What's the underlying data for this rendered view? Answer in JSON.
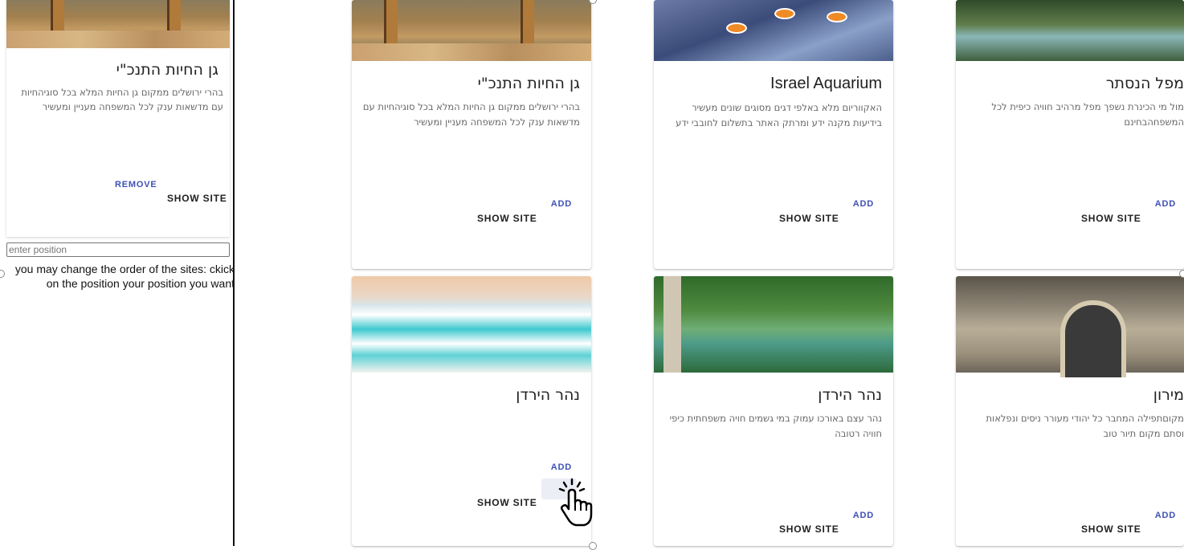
{
  "sidebar": {
    "selected_card": {
      "title": "גן החיות התנכ\"י",
      "description": "בהרי ירושלים ממקום גן החיות המלא בכל סוגיהחיות עם מדשאות ענק לכל המשפחה מעניין ומעשיר",
      "remove_label": "REMOVE",
      "show_site_label": "SHOW SITE"
    },
    "position_input": {
      "placeholder": "enter position",
      "value": ""
    },
    "hint": "you may change the order of the sites: ckick on the position your position you want"
  },
  "cards": [
    {
      "title": "גן החיות התנכ\"י",
      "description": "בהרי ירושלים ממקום גן החיות המלא בכל סוגיהחיות עם מדשאות ענק לכל המשפחה מעניין ומעשיר",
      "add_label": "ADD",
      "show_site_label": "SHOW SITE"
    },
    {
      "title": "Israel Aquarium",
      "description": "האקווריום מלא באלפי דגים מסוגים שונים מעשיר בידיעות מקנה ידע ומרתק האתר בתשלום לחובבי ידע",
      "add_label": "ADD",
      "show_site_label": "SHOW SITE"
    },
    {
      "title": "מפל הנסתר",
      "description": "מול מי הכינרת נשפך מפל מרהיב חוויה כיפית לכל המשפחהבחינם",
      "add_label": "ADD",
      "show_site_label": "SHOW SITE"
    },
    {
      "title": "נהר הירדן",
      "description": "",
      "add_label": "ADD",
      "show_site_label": "SHOW SITE"
    },
    {
      "title": "נהר הירדן",
      "description": "נהר עצם באורכו עמוק במי גשמים חויה משפחתית כיפי חוויה רטובה",
      "add_label": "ADD",
      "show_site_label": "SHOW SITE"
    },
    {
      "title": "מירון",
      "description": "מקוםתפילה המחבר כל יהודי מעורר ניסים ונפלאות וסתם מקום תיור טוב",
      "add_label": "ADD",
      "show_site_label": "SHOW SITE"
    }
  ]
}
